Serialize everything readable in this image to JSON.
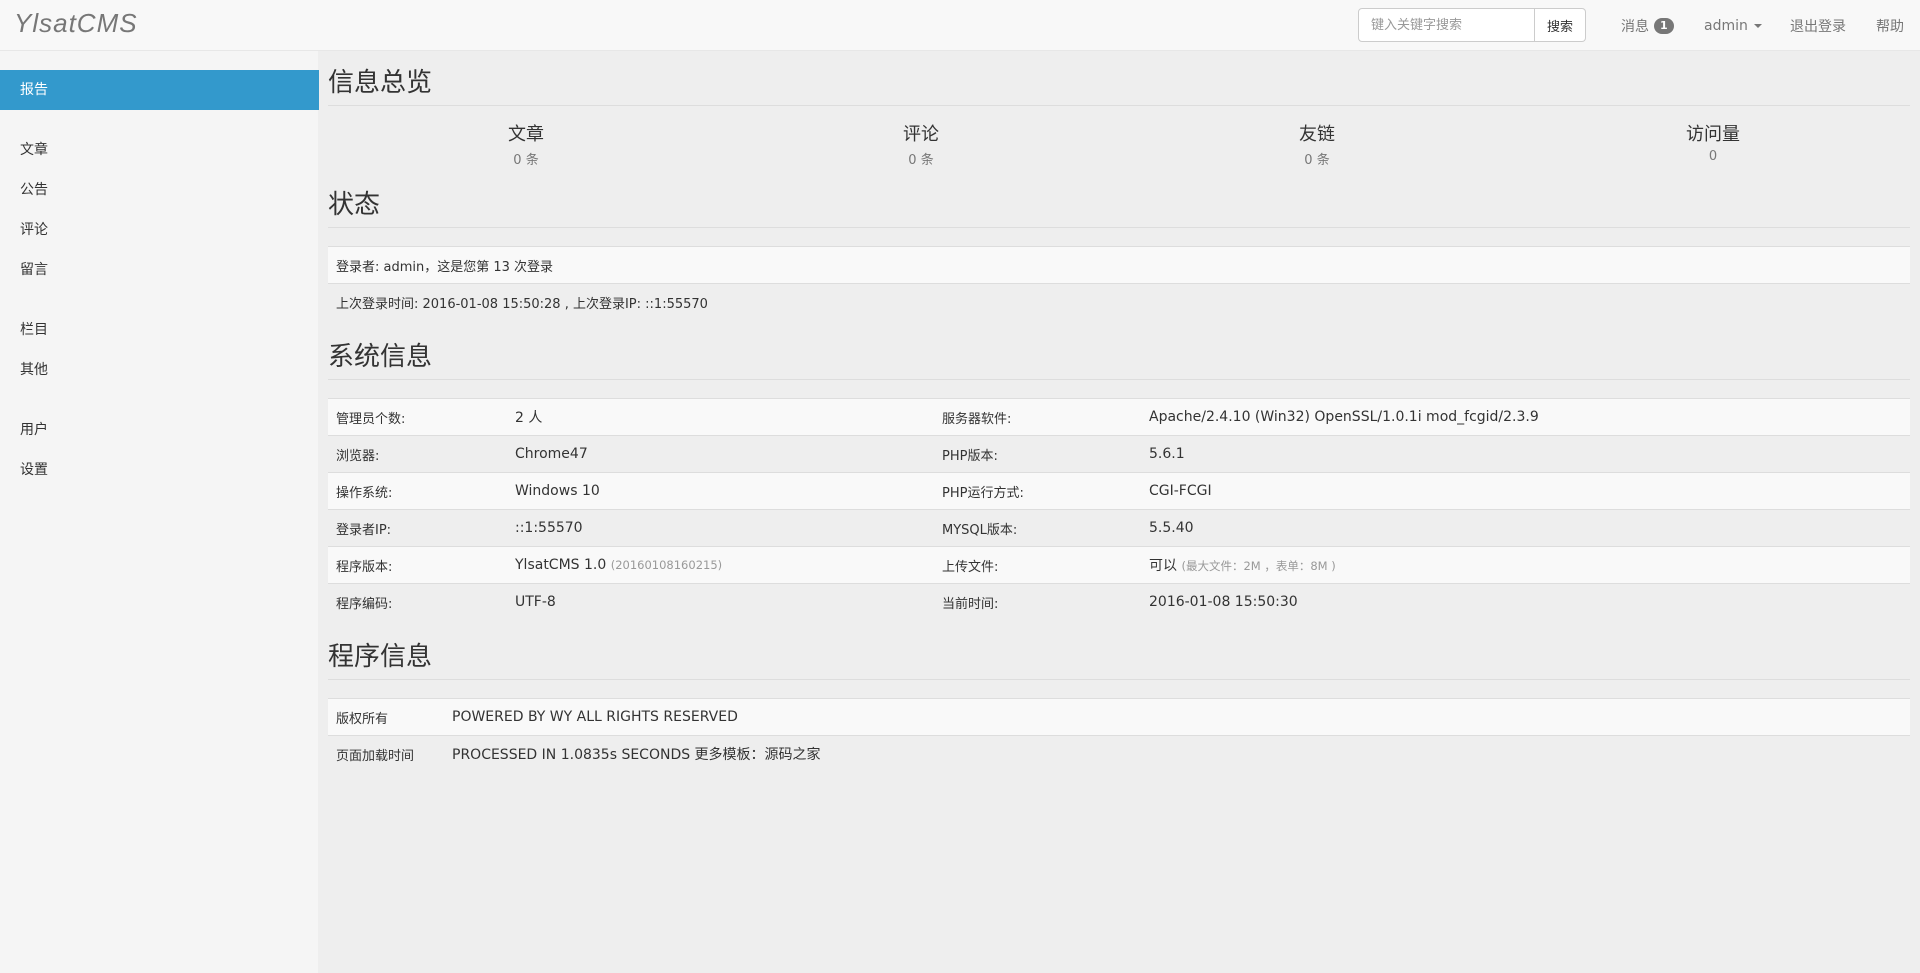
{
  "app": {
    "brand": "YlsatCMS"
  },
  "topbar": {
    "search_placeholder": "键入关键字搜索",
    "search_button": "搜索",
    "messages_label": "消息",
    "messages_count": "1",
    "user_label": "admin",
    "logout_label": "退出登录",
    "help_label": "帮助"
  },
  "sidebar": {
    "items": [
      {
        "label": "报告",
        "active": true
      },
      {
        "label": "文章"
      },
      {
        "label": "公告"
      },
      {
        "label": "评论"
      },
      {
        "label": "留言"
      },
      {
        "label": "栏目"
      },
      {
        "label": "其他"
      },
      {
        "label": "用户"
      },
      {
        "label": "设置"
      }
    ]
  },
  "overview": {
    "title": "信息总览",
    "cells": [
      {
        "label": "文章",
        "value": "0 条"
      },
      {
        "label": "评论",
        "value": "0 条"
      },
      {
        "label": "友链",
        "value": "0 条"
      },
      {
        "label": "访问量",
        "value": "0"
      }
    ]
  },
  "status": {
    "title": "状态",
    "rows": [
      "登录者: admin，这是您第 13 次登录",
      "上次登录时间: 2016-01-08 15:50:28 , 上次登录IP: ::1:55570"
    ]
  },
  "system": {
    "title": "系统信息",
    "rows": [
      {
        "k1": "管理员个数:",
        "v1": "2 人",
        "k2": "服务器软件:",
        "v2": "Apache/2.4.10 (Win32) OpenSSL/1.0.1i mod_fcgid/2.3.9"
      },
      {
        "k1": "浏览器:",
        "v1": "Chrome47",
        "k2": "PHP版本:",
        "v2": "5.6.1"
      },
      {
        "k1": "操作系统:",
        "v1": "Windows 10",
        "k2": "PHP运行方式:",
        "v2": "CGI-FCGI"
      },
      {
        "k1": "登录者IP:",
        "v1": "::1:55570",
        "k2": "MYSQL版本:",
        "v2": "5.5.40"
      },
      {
        "k1": "程序版本:",
        "v1": "YlsatCMS 1.0",
        "v1_note": "(20160108160215)",
        "k2": "上传文件:",
        "v2": "可以",
        "v2_note": "(最大文件：2M ，表单：8M )"
      },
      {
        "k1": "程序编码:",
        "v1": "UTF-8",
        "k2": "当前时间:",
        "v2": "2016-01-08 15:50:30"
      }
    ]
  },
  "program": {
    "title": "程序信息",
    "rows": [
      {
        "k": "版权所有",
        "v": "POWERED BY WY ALL RIGHTS RESERVED"
      },
      {
        "k": "页面加载时间",
        "v": "PROCESSED IN 1.0835s SECONDS 更多模板：源码之家"
      }
    ]
  },
  "colors": {
    "accent": "#3399cc",
    "page_bg": "#eeeeee",
    "sidebar_bg": "#f5f5f5"
  }
}
